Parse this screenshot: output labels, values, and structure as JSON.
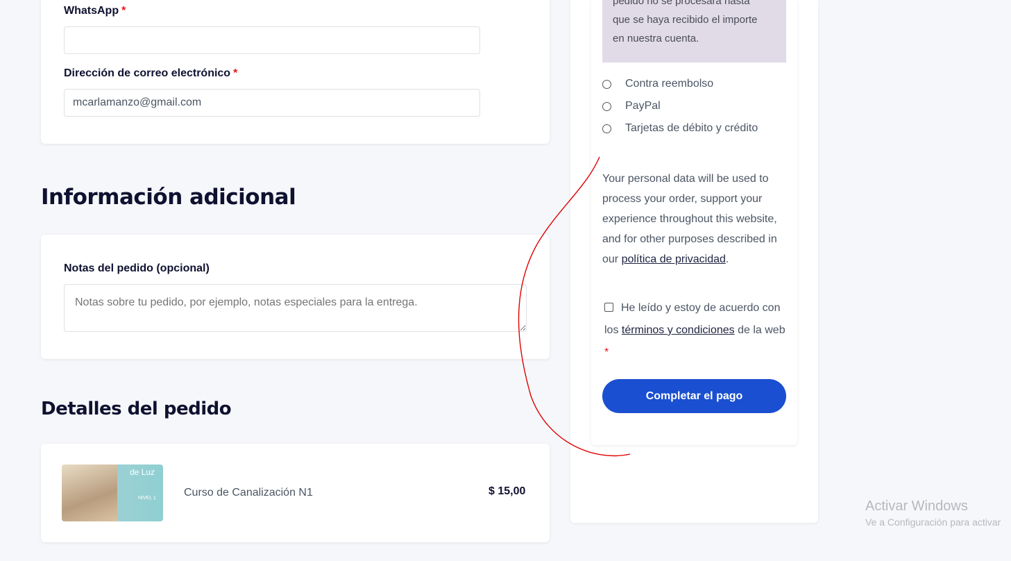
{
  "contact": {
    "whatsapp_label": "WhatsApp",
    "whatsapp_value": "",
    "email_label": "Dirección de correo electrónico",
    "email_value": "mcarlamanzo@gmail.com",
    "required_mark": "*"
  },
  "additional_info": {
    "heading": "Información adicional",
    "notes_label": "Notas del pedido (opcional)",
    "notes_placeholder": "Notas sobre tu pedido, por ejemplo, notas especiales para la entrega."
  },
  "order_details": {
    "heading": "Detalles del pedido",
    "item": {
      "name": "Curso de Canalización N1",
      "price": "$ 15,00",
      "thumb_title": "de Luz",
      "thumb_level": "NIVEL 1"
    }
  },
  "payment": {
    "notice_lines": [
      "pedido no se procesará hasta",
      "que se haya recibido el importe",
      "en nuestra cuenta."
    ],
    "methods": [
      "Contra reembolso",
      "PayPal",
      "Tarjetas de débito y crédito"
    ],
    "privacy_text": "Your personal data will be used to process your order, support your experience throughout this website, and for other purposes described in our",
    "privacy_link": "política de privacidad",
    "privacy_end": ".",
    "terms_prefix": "He leído y estoy de acuerdo con los",
    "terms_link": "términos y condiciones",
    "terms_suffix": "de la web",
    "required_mark": "*",
    "submit_label": "Completar el pago"
  },
  "watermark": {
    "title": "Activar Windows",
    "subtitle": "Ve a Configuración para activar"
  },
  "colors": {
    "accent": "#1a4fd1",
    "heading": "#0f1130",
    "annotation": "#e00000"
  }
}
